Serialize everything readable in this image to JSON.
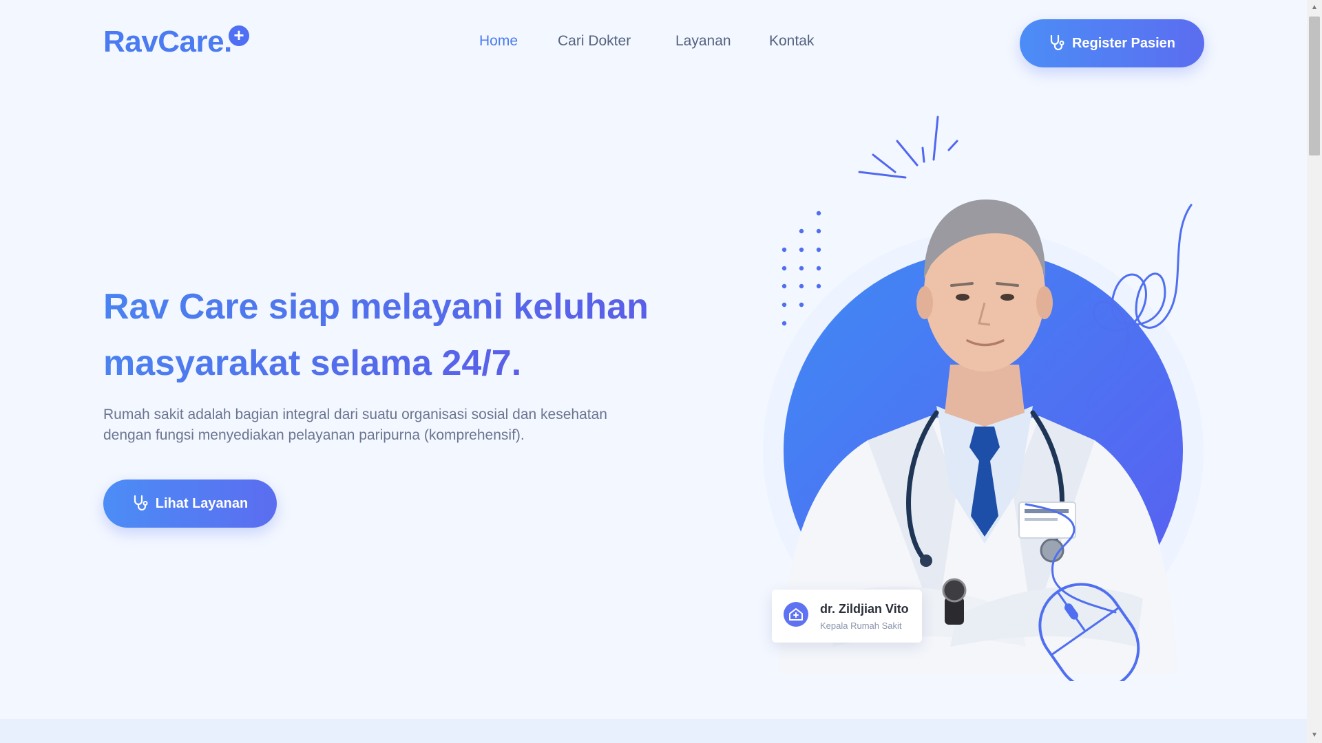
{
  "brand": {
    "name": "RavCare.",
    "plus_symbol": "+"
  },
  "nav": {
    "items": [
      {
        "label": "Home",
        "active": true
      },
      {
        "label": "Cari Dokter",
        "active": false
      },
      {
        "label": "Layanan",
        "active": false
      },
      {
        "label": "Kontak",
        "active": false
      }
    ]
  },
  "header": {
    "register_label": "Register Pasien",
    "register_icon": "stethoscope-icon"
  },
  "hero": {
    "title_line1": "Rav Care siap melayani keluhan",
    "title_line2": "masyarakat selama 24/7.",
    "description_line1": "Rumah sakit adalah bagian integral dari suatu organisasi sosial dan kesehatan",
    "description_line2": "dengan fungsi menyediakan pelayanan paripurna (komprehensif).",
    "cta_label": "Lihat Layanan",
    "cta_icon": "stethoscope-icon"
  },
  "doctor_card": {
    "name": "dr. Zildjian Vito",
    "role": "Kepala Rumah Sakit",
    "icon": "hospital-icon"
  },
  "colors": {
    "primary": "#4a7bf0",
    "gradient_start": "#4c8df6",
    "gradient_end": "#5b6df0",
    "background": "#f3f7ff",
    "text_muted": "#6b7590"
  }
}
